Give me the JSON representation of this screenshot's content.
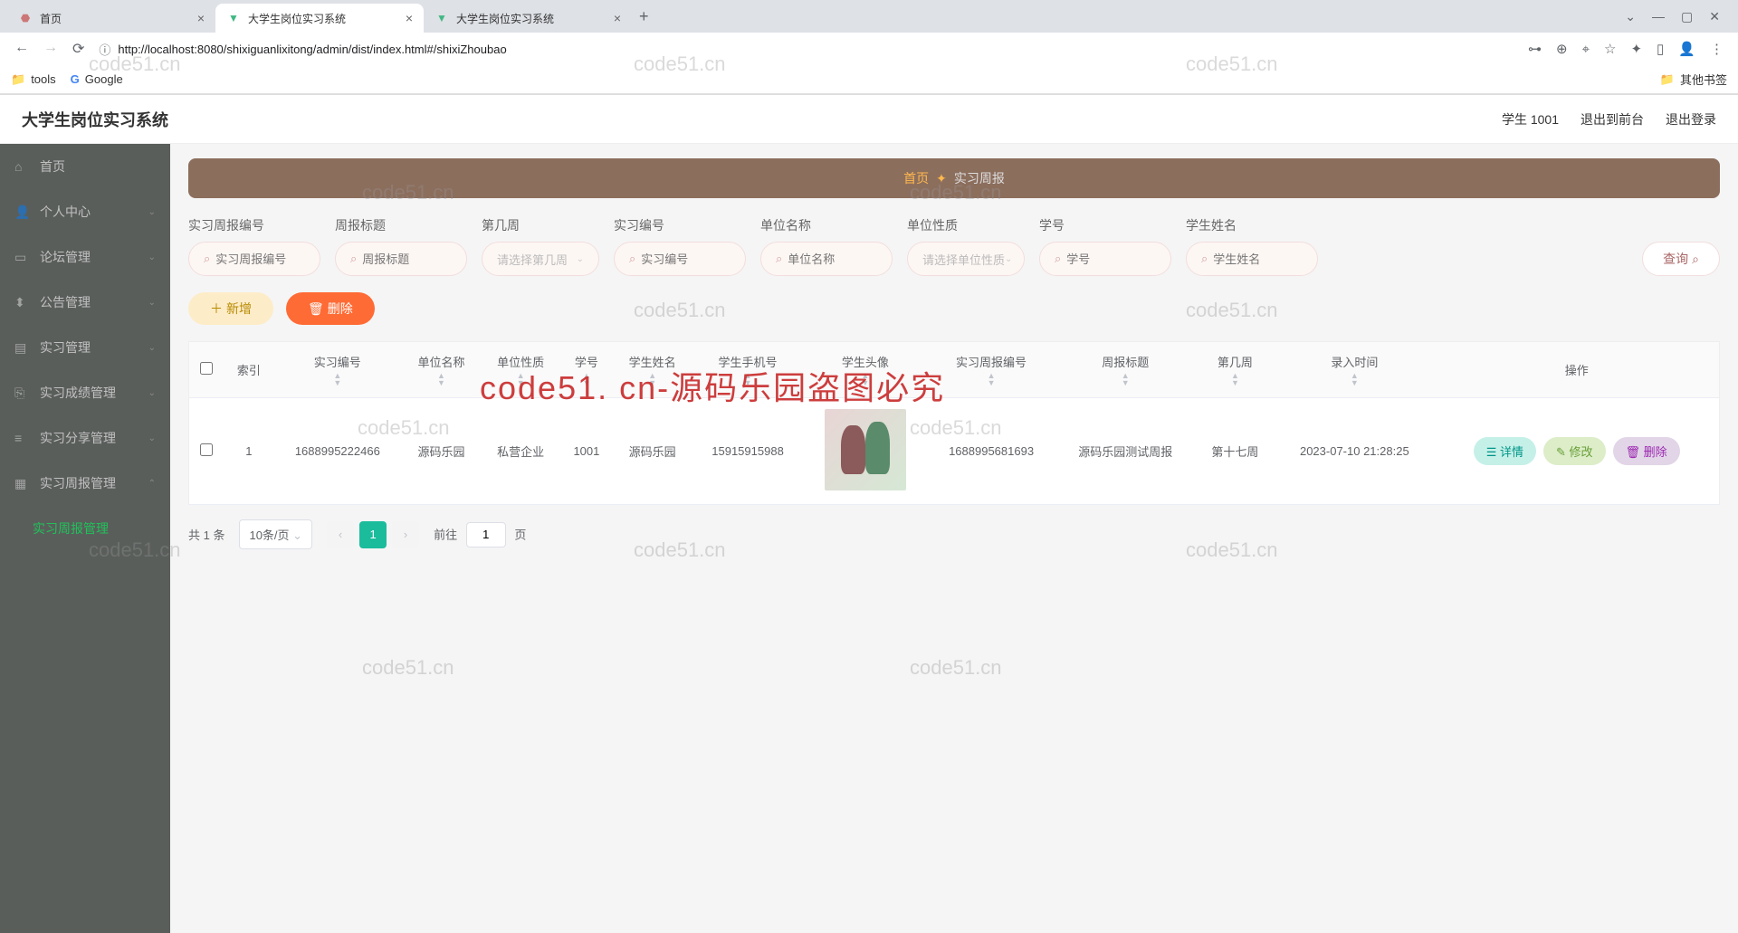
{
  "browser": {
    "tabs": [
      {
        "title": "首页",
        "favicon": "🏠",
        "active": false
      },
      {
        "title": "大学生岗位实习系统",
        "favicon": "V",
        "active": true
      },
      {
        "title": "大学生岗位实习系统",
        "favicon": "V",
        "active": false
      }
    ],
    "url": "http://localhost:8080/shixiguanlixitong/admin/dist/index.html#/shixiZhoubao",
    "bookmarks": {
      "tools": "tools",
      "google": "Google",
      "other": "其他书签"
    }
  },
  "header": {
    "title": "大学生岗位实习系统",
    "user": "学生 1001",
    "exit_front": "退出到前台",
    "logout": "退出登录"
  },
  "sidebar": {
    "items": [
      {
        "label": "首页",
        "icon": "⌂"
      },
      {
        "label": "个人中心",
        "icon": "👤",
        "expand": true
      },
      {
        "label": "论坛管理",
        "icon": "▭",
        "expand": true
      },
      {
        "label": "公告管理",
        "icon": "⬍",
        "expand": true
      },
      {
        "label": "实习管理",
        "icon": "▤",
        "expand": true
      },
      {
        "label": "实习成绩管理",
        "icon": "⎘",
        "expand": true
      },
      {
        "label": "实习分享管理",
        "icon": "≡",
        "expand": true
      },
      {
        "label": "实习周报管理",
        "icon": "▦",
        "expand": true,
        "open": true
      }
    ],
    "sub_active": "实习周报管理"
  },
  "breadcrumb": {
    "home": "首页",
    "current": "实习周报"
  },
  "search": {
    "fields": [
      {
        "label": "实习周报编号",
        "placeholder": "实习周报编号",
        "type": "text"
      },
      {
        "label": "周报标题",
        "placeholder": "周报标题",
        "type": "text"
      },
      {
        "label": "第几周",
        "placeholder": "请选择第几周",
        "type": "select"
      },
      {
        "label": "实习编号",
        "placeholder": "实习编号",
        "type": "text"
      },
      {
        "label": "单位名称",
        "placeholder": "单位名称",
        "type": "text"
      },
      {
        "label": "单位性质",
        "placeholder": "请选择单位性质",
        "type": "select"
      },
      {
        "label": "学号",
        "placeholder": "学号",
        "type": "text"
      },
      {
        "label": "学生姓名",
        "placeholder": "学生姓名",
        "type": "text"
      }
    ],
    "query_btn": "查询"
  },
  "actions": {
    "add": "新增",
    "delete": "删除"
  },
  "table": {
    "headers": [
      "",
      "索引",
      "实习编号",
      "单位名称",
      "单位性质",
      "学号",
      "学生姓名",
      "学生手机号",
      "学生头像",
      "实习周报编号",
      "周报标题",
      "第几周",
      "录入时间",
      "操作"
    ],
    "rows": [
      {
        "index": "1",
        "sx_no": "1688995222466",
        "unit_name": "源码乐园",
        "unit_type": "私营企业",
        "student_no": "1001",
        "student_name": "源码乐园",
        "phone": "15915915988",
        "img": true,
        "report_no": "1688995681693",
        "report_title": "源码乐园测试周报",
        "week": "第十七周",
        "time": "2023-07-10 21:28:25"
      }
    ],
    "row_actions": {
      "detail": "详情",
      "edit": "修改",
      "delete": "删除"
    }
  },
  "pagination": {
    "total_text": "共 1 条",
    "page_size": "10条/页",
    "current": "1",
    "goto_prefix": "前往",
    "goto_value": "1",
    "goto_suffix": "页"
  },
  "watermarks": {
    "grey": "code51.cn",
    "red": "code51. cn-源码乐园盗图必究"
  }
}
